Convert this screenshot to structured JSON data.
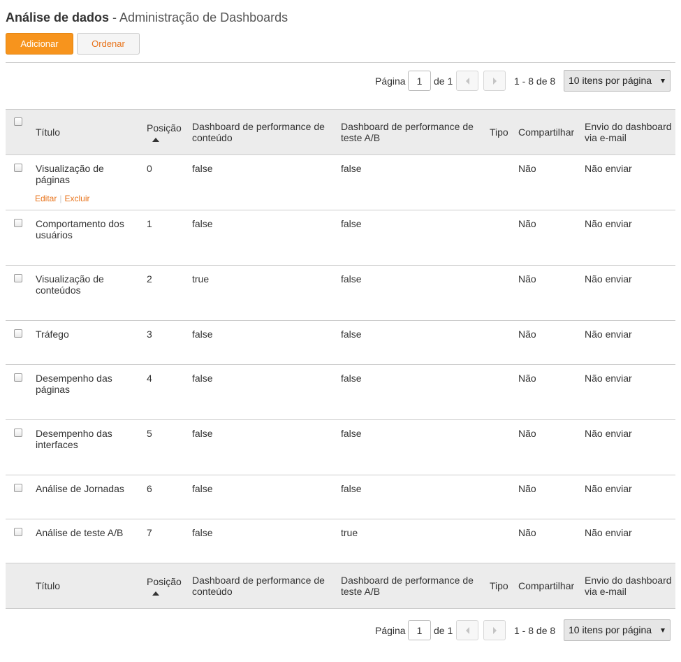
{
  "page": {
    "title_bold": "Análise de dados",
    "title_rest": " - Administração de Dashboards"
  },
  "toolbar": {
    "add_label": "Adicionar",
    "order_label": "Ordenar"
  },
  "pager": {
    "page_label": "Página",
    "page_value": "1",
    "of_label": "de 1",
    "range_label": "1 - 8 de 8",
    "per_page": "10 itens por página",
    "prev_icon": "chevron-left-icon",
    "next_icon": "chevron-right-icon"
  },
  "table": {
    "columns": [
      "Título",
      "Posição",
      "Dashboard de performance de conteúdo",
      "Dashboard de performance de teste A/B",
      "Tipo",
      "Compartilhar",
      "Envio do dashboard via e-mail"
    ],
    "sort_icon": "sort-ascending-icon",
    "row_actions": {
      "edit": "Editar",
      "delete": "Excluir"
    },
    "rows": [
      {
        "titulo": "Visualização de páginas",
        "posicao": "0",
        "conteudo": "false",
        "teste_ab": "false",
        "tipo": "",
        "compartilhar": "Não",
        "envio": "Não enviar"
      },
      {
        "titulo": "Comportamento dos usuários",
        "posicao": "1",
        "conteudo": "false",
        "teste_ab": "false",
        "tipo": "",
        "compartilhar": "Não",
        "envio": "Não enviar"
      },
      {
        "titulo": "Visualização de conteúdos",
        "posicao": "2",
        "conteudo": "true",
        "teste_ab": "false",
        "tipo": "",
        "compartilhar": "Não",
        "envio": "Não enviar"
      },
      {
        "titulo": "Tráfego",
        "posicao": "3",
        "conteudo": "false",
        "teste_ab": "false",
        "tipo": "",
        "compartilhar": "Não",
        "envio": "Não enviar"
      },
      {
        "titulo": "Desempenho das páginas",
        "posicao": "4",
        "conteudo": "false",
        "teste_ab": "false",
        "tipo": "",
        "compartilhar": "Não",
        "envio": "Não enviar"
      },
      {
        "titulo": "Desempenho das interfaces",
        "posicao": "5",
        "conteudo": "false",
        "teste_ab": "false",
        "tipo": "",
        "compartilhar": "Não",
        "envio": "Não enviar"
      },
      {
        "titulo": "Análise de Jornadas",
        "posicao": "6",
        "conteudo": "false",
        "teste_ab": "false",
        "tipo": "",
        "compartilhar": "Não",
        "envio": "Não enviar"
      },
      {
        "titulo": "Análise de teste A/B",
        "posicao": "7",
        "conteudo": "false",
        "teste_ab": "true",
        "tipo": "",
        "compartilhar": "Não",
        "envio": "Não enviar"
      }
    ]
  },
  "colors": {
    "accent": "#f7941d",
    "link": "#e8731a",
    "header_bg": "#ececec",
    "border": "#cccccc"
  }
}
